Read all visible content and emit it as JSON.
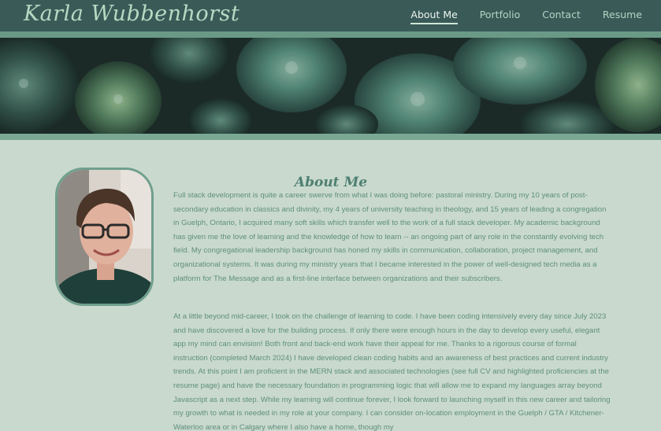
{
  "header": {
    "site_title": "Karla Wubbenhorst",
    "nav": [
      {
        "label": "About Me",
        "active": true
      },
      {
        "label": "Portfolio",
        "active": false
      },
      {
        "label": "Contact",
        "active": false
      },
      {
        "label": "Resume",
        "active": false
      }
    ]
  },
  "colors": {
    "navbar": "#3a5a58",
    "accent": "#6f9f8d",
    "background": "#c9d9cd",
    "text": "#5e8f7d"
  },
  "hero": {
    "image": "succulent-plants-banner"
  },
  "about": {
    "heading": "About Me",
    "portrait": "profile-photo",
    "paragraphs": [
      "Full stack development is quite a career swerve from what I was doing before: pastoral ministry. During my 10 years of post-secondary education in classics and divinity, my 4 years of university teaching in theology, and 15 years of leading a congregation in Guelph, Ontario, I acquired many soft skills which transfer well to the work of a full stack developer. My academic background has given me the love of learning and the knowledge of how to learn -- an ongoing part of any role in the constantly evolving tech field. My congregational leadership background has honed my skills in communication, collaboration, project management, and organizational systems. It was during my ministry years that I became interested in the power of well-designed tech media as a platform for The Message and as a first-line interface between organizations and their subscribers.",
      "At a little beyond mid-career, I took on the challenge of learning to code. I have been coding intensively every day since July 2023 and have discovered a love for the building process. If only there were enough hours in the day to develop every useful, elegant app my mind can envision! Both front and back-end work have their appeal for me. Thanks to a rigorous course of formal instruction (completed March 2024) I have developed clean coding habits and an awareness of best practices and current industry trends. At this point I am proficient in the MERN stack and associated technologies (see full CV and highlighted proficiencies at the resume page) and have the necessary foundation in programming logic that will allow me to expand my languages array beyond Javascript as a next step. While my learning will continue forever, I look forward to launching myself in this new career and tailoring my growth to what is needed in my role at your company. I can consider on-location employment in the Guelph / GTA / Kitchener-Waterloo area or in Calgary where I also have a home, though my"
    ]
  }
}
